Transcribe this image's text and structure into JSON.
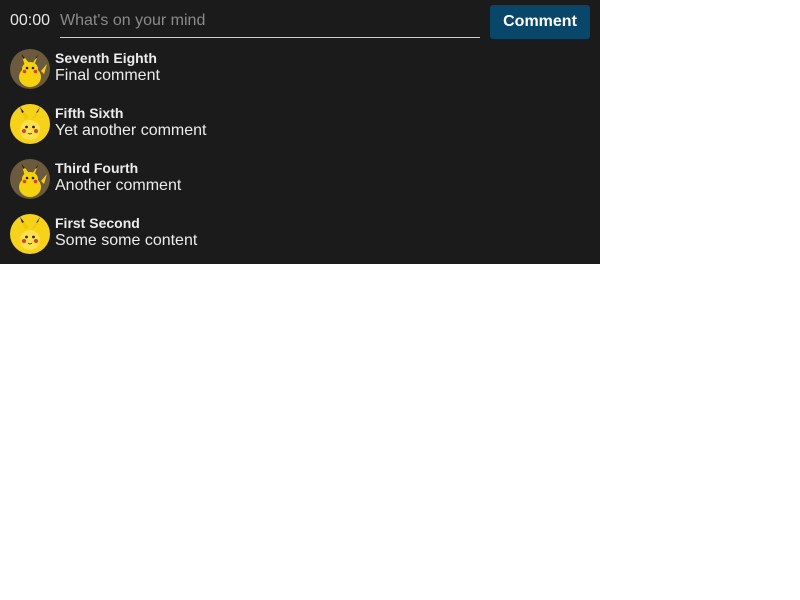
{
  "composer": {
    "timer": "00:00",
    "placeholder": "What's on your mind",
    "value": "",
    "button_label": "Comment"
  },
  "comments": [
    {
      "author": "Seventh Eighth",
      "content": "Final comment",
      "avatar_icon": "pikachu-sitting-icon",
      "avatar_bg": "#6b5a3e"
    },
    {
      "author": "Fifth Sixth",
      "content": "Yet another comment",
      "avatar_icon": "pikachu-face-icon",
      "avatar_bg": "#f7d21b"
    },
    {
      "author": "Third Fourth",
      "content": "Another comment",
      "avatar_icon": "pikachu-sitting-icon",
      "avatar_bg": "#6b5a3e"
    },
    {
      "author": "First Second",
      "content": "Some some content",
      "avatar_icon": "pikachu-face-icon",
      "avatar_bg": "#f7d21b"
    }
  ],
  "colors": {
    "panel_bg": "#1b1b1b",
    "button_bg": "#08466a",
    "text": "#ececec",
    "placeholder": "#8a8a8a"
  }
}
